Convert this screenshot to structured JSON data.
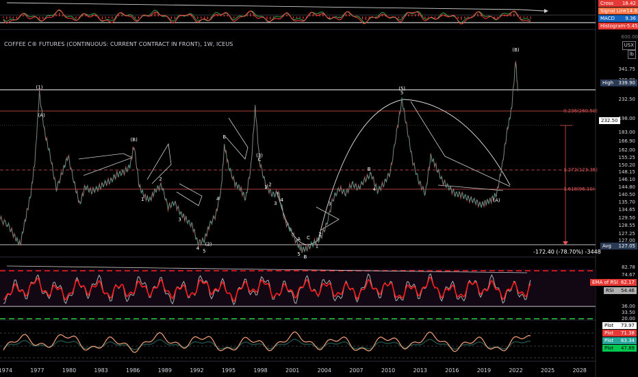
{
  "header": {
    "title": "COFFEE C® FUTURES (CONTINUOUS: CURRENT CONTRACT IN FRONT), 1W, ICEUS",
    "currency": "USX",
    "unit": "lb"
  },
  "colors": {
    "background": "#000000",
    "price": "#26a69a",
    "price_down": "#ef5350",
    "grid": "#1c1f26",
    "fib_line": "#e05555",
    "rsi": "#b0b0b0",
    "ema_rsi": "#ff1a1a",
    "plot_orange": "#f5a37a",
    "plot_dark": "#1f4d45",
    "green_dash": "#2ecc40",
    "white": "#ffffff"
  },
  "chart_data": [
    {
      "type": "line",
      "panel": "macd",
      "legend": [
        {
          "name": "Cross",
          "value": "18.42",
          "color": "#e53935"
        },
        {
          "name": "Signal Line",
          "value": "14.82",
          "color": "#ff7043"
        },
        {
          "name": "MACD",
          "value": "9.36",
          "color": "#1565c0"
        },
        {
          "name": "Histogram",
          "value": "-5.45",
          "color": "#e53935"
        }
      ]
    },
    {
      "type": "line",
      "panel": "price",
      "x_ticks": [
        "1974",
        "1977",
        "1980",
        "1983",
        "1986",
        "1989",
        "1992",
        "1995",
        "1998",
        "2001",
        "2004",
        "2007",
        "2010",
        "2013",
        "2016",
        "2019",
        "2022",
        "2025",
        "2028"
      ],
      "y_ticks": [
        341.75,
        308.9,
        232.5,
        198.0,
        183.0,
        166.9,
        162.0,
        155.25,
        150.2,
        148.15,
        146.1,
        144.8,
        140.5,
        135.7,
        134.65,
        129.5,
        128.55,
        127.25,
        127.0
      ],
      "scale_label": "600.00",
      "x": [
        1973.5,
        1974.3,
        1974.9,
        1975.4,
        1975.9,
        1976.4,
        1976.8,
        1977.2,
        1977.7,
        1978.2,
        1978.8,
        1979.4,
        1979.9,
        1980.5,
        1981.0,
        1981.5,
        1982.1,
        1982.7,
        1983.3,
        1983.9,
        1984.5,
        1985.1,
        1985.7,
        1986.1,
        1986.6,
        1987.1,
        1987.6,
        1988.1,
        1988.7,
        1989.3,
        1989.9,
        1990.5,
        1991.0,
        1991.6,
        1992.1,
        1992.7,
        1993.2,
        1993.8,
        1994.3,
        1994.6,
        1995.0,
        1995.6,
        1996.1,
        1996.6,
        1997.1,
        1997.5,
        1997.9,
        1998.5,
        1999.1,
        1999.7,
        2000.3,
        2000.9,
        2001.5,
        2001.9,
        2002.4,
        2003.0,
        2003.6,
        2004.2,
        2004.8,
        2005.4,
        2006.0,
        2006.6,
        2007.2,
        2007.8,
        2008.4,
        2009.0,
        2009.6,
        2010.2,
        2010.8,
        2011.3,
        2011.8,
        2012.3,
        2012.9,
        2013.5,
        2014.0,
        2014.5,
        2015.1,
        2015.7,
        2016.3,
        2016.9,
        2017.5,
        2018.1,
        2018.7,
        2019.2,
        2019.7,
        2020.2,
        2020.7,
        2021.2,
        2021.6,
        2022.0,
        2022.2
      ],
      "y": [
        138.9,
        136.4,
        132.1,
        129.4,
        138.9,
        148.2,
        161.1,
        185.6,
        171.0,
        162.8,
        149.9,
        156.6,
        162.2,
        151.9,
        144.2,
        150.8,
        149.1,
        150.2,
        151.9,
        153.0,
        155.3,
        156.1,
        158.3,
        166.1,
        150.9,
        147.1,
        145.9,
        149.5,
        151.3,
        143.2,
        145.0,
        140.9,
        138.8,
        136.2,
        129.9,
        131.0,
        136.6,
        140.5,
        150.0,
        166.1,
        158.4,
        151.9,
        150.2,
        146.2,
        158.3,
        180.5,
        160.3,
        151.2,
        147.9,
        148.4,
        138.2,
        134.2,
        129.3,
        127.4,
        128.0,
        129.9,
        131.6,
        136.6,
        146.1,
        150.2,
        148.2,
        151.9,
        150.2,
        153.3,
        155.5,
        149.2,
        151.9,
        156.2,
        171.2,
        183.0,
        171.9,
        160.3,
        152.6,
        148.2,
        162.1,
        158.3,
        152.9,
        150.6,
        148.2,
        147.8,
        146.5,
        145.6,
        144.0,
        145.0,
        145.9,
        148.2,
        158.3,
        171.9,
        179.6,
        197.9,
        185.0
      ],
      "levels": [
        {
          "label": "High",
          "value": "339.90"
        },
        {
          "label": "0.236(260.50)",
          "value": "260.50"
        },
        {
          "label": "1.272(123.35)",
          "value": "123.35"
        },
        {
          "label": "1.618(96.10)",
          "value": "96.10"
        },
        {
          "label": "Avg",
          "value": "127.05"
        }
      ],
      "current_price": "232.50",
      "measure_label": "-172.40 (-78.70%) -3448",
      "wave_labels": [
        "(1)",
        "(A)",
        "(B)",
        "1",
        "2",
        "3",
        "4",
        "A",
        "B",
        "5",
        "(2)",
        "(3)",
        "C",
        "4",
        "1",
        "2",
        "3",
        "5",
        "B",
        "A",
        "C",
        "1",
        "2",
        "3",
        "4",
        "5",
        "B",
        "(5)",
        "(A)",
        "(B)"
      ]
    },
    {
      "type": "line",
      "panel": "rsi",
      "y_ticks": [
        82.78,
        74.67,
        36.0,
        33.5,
        20.0
      ],
      "legend": [
        {
          "name": "EMA of RSI",
          "value": "62.17",
          "color": "#e53935"
        },
        {
          "name": "RSI",
          "value": "54.46",
          "color": "#b0b0b0"
        }
      ]
    },
    {
      "type": "line",
      "panel": "plots",
      "legend": [
        {
          "name": "Plot",
          "value": "73.97",
          "color": "#ffffff"
        },
        {
          "name": "Plot",
          "value": "71.38",
          "color": "#e53935"
        },
        {
          "name": "Plot",
          "value": "63.34",
          "color": "#26a69a"
        },
        {
          "name": "Plot",
          "value": "47.89",
          "color": "#00c853"
        }
      ]
    }
  ]
}
